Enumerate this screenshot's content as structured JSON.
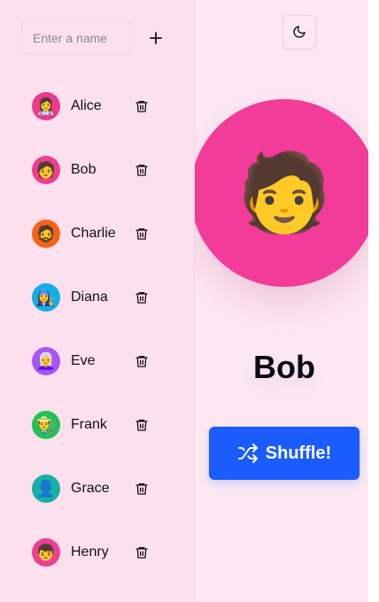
{
  "input": {
    "placeholder": "Enter a name",
    "value": ""
  },
  "people": [
    {
      "name": "Alice",
      "emoji": "👩‍⚕️",
      "color": "#ec3a8e"
    },
    {
      "name": "Bob",
      "emoji": "🧑",
      "color": "#ee3e92"
    },
    {
      "name": "Charlie",
      "emoji": "🧔",
      "color": "#f86416"
    },
    {
      "name": "Diana",
      "emoji": "👩‍🔧",
      "color": "#13aee8"
    },
    {
      "name": "Eve",
      "emoji": "👩‍🦳",
      "color": "#a855f7"
    },
    {
      "name": "Frank",
      "emoji": "👨‍🌾",
      "color": "#1fc35a"
    },
    {
      "name": "Grace",
      "emoji": "👤",
      "color": "#16b1a4"
    },
    {
      "name": "Henry",
      "emoji": "👦",
      "color": "#ee3e92"
    }
  ],
  "selected": {
    "name": "Bob",
    "emoji": "🧑",
    "color": "#f33b9a"
  },
  "shuffle": {
    "label": "Shuffle!"
  },
  "icons": {
    "add": "plus-icon",
    "delete": "trash-icon",
    "theme": "moon-icon",
    "shuffle": "shuffle-icon"
  },
  "colors": {
    "sidebar_bg": "#fde0ee",
    "main_bg": "#fde8f2",
    "accent": "#1a5cff"
  }
}
